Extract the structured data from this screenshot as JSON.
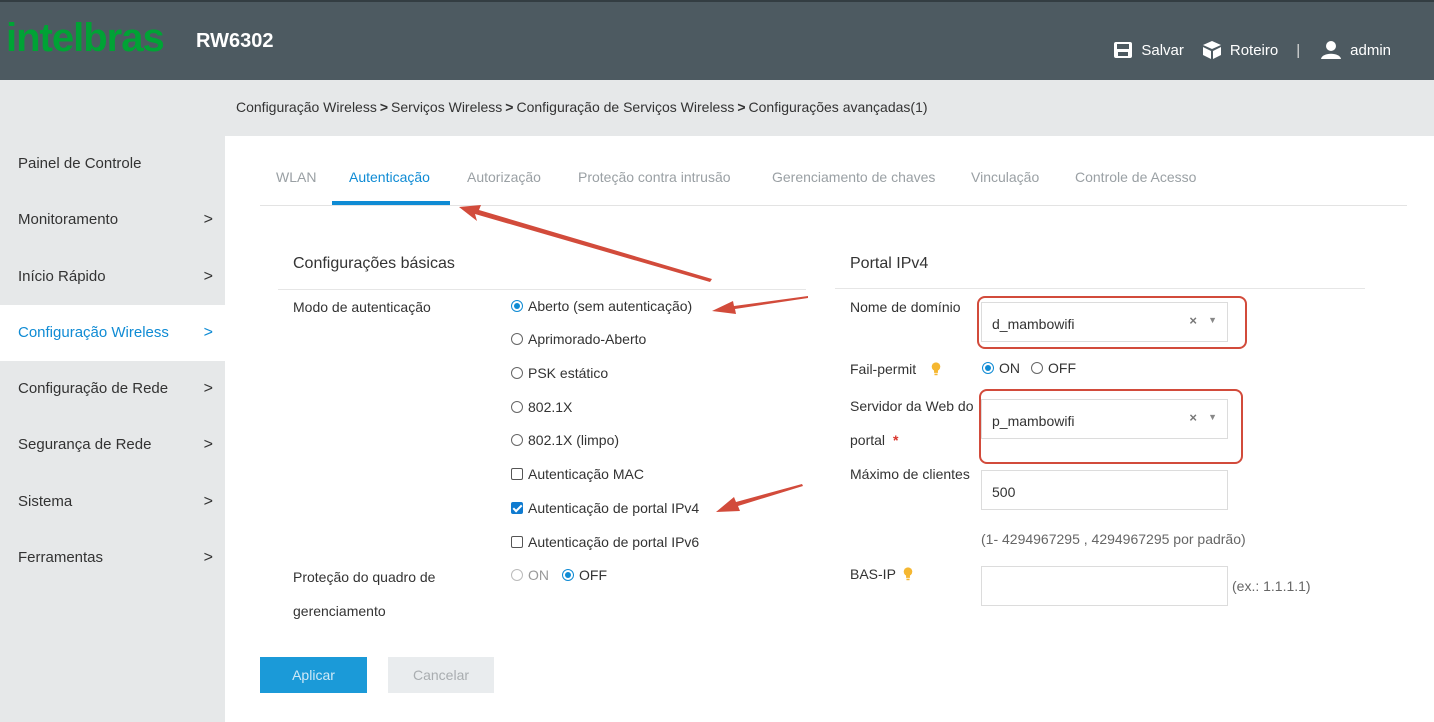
{
  "header": {
    "logo_text": "intelbras",
    "model": "RW6302",
    "save_label": "Salvar",
    "roadmap_label": "Roteiro",
    "separator": "|",
    "user_label": "admin",
    "brand_color": "#00a335",
    "bar_color": "#4d5a61"
  },
  "breadcrumb": {
    "items": [
      "Configuração Wireless",
      "Serviços Wireless",
      "Configuração de Serviços Wireless",
      "Configurações avançadas(1)"
    ],
    "separator": ">"
  },
  "sidebar": {
    "items": [
      {
        "label": "Painel de Controle",
        "has_arrow": false
      },
      {
        "label": "Monitoramento",
        "has_arrow": true
      },
      {
        "label": "Início Rápido",
        "has_arrow": true
      },
      {
        "label": "Configuração Wireless",
        "has_arrow": true,
        "active": true
      },
      {
        "label": "Configuração de Rede",
        "has_arrow": true
      },
      {
        "label": "Segurança de Rede",
        "has_arrow": true
      },
      {
        "label": "Sistema",
        "has_arrow": true
      },
      {
        "label": "Ferramentas",
        "has_arrow": true
      }
    ],
    "arrow": ">",
    "active_color": "#0f8bd4"
  },
  "tabs": {
    "items": [
      "WLAN",
      "Autenticação",
      "Autorização",
      "Proteção contra intrusão",
      "Gerenciamento de chaves",
      "Vinculação",
      "Controle de Acesso"
    ],
    "active": "Autenticação"
  },
  "basic": {
    "title": "Configurações básicas",
    "auth_mode_label": "Modo de autenticação",
    "auth_options": [
      "Aberto (sem autenticação)",
      "Aprimorado-Aberto",
      "PSK estático",
      "802.1X",
      "802.1X (limpo)"
    ],
    "auth_selected": "Aberto (sem autenticação)",
    "checkboxes": [
      {
        "label": "Autenticação MAC",
        "checked": false
      },
      {
        "label": "Autenticação de portal IPv4",
        "checked": true
      },
      {
        "label": "Autenticação de portal IPv6",
        "checked": false
      }
    ],
    "mgmt_frame_label_1": "Proteção do quadro de",
    "mgmt_frame_label_2": "gerenciamento",
    "mgmt_on": "ON",
    "mgmt_off": "OFF",
    "mgmt_selected": "OFF"
  },
  "portal": {
    "title": "Portal IPv4",
    "domain_label": "Nome de domínio",
    "domain_value": "d_mambowifi",
    "failpermit_label": "Fail-permit",
    "failpermit_on": "ON",
    "failpermit_off": "OFF",
    "failpermit_selected": "ON",
    "webserver_label_1": "Servidor da Web do",
    "webserver_label_2": "portal",
    "required_mark": "*",
    "webserver_value": "p_mambowifi",
    "max_clients_label": "Máximo de clientes",
    "max_clients_value": "500",
    "max_clients_hint": "(1- 4294967295 , 4294967295 por padrão)",
    "basip_label": "BAS-IP",
    "basip_value": "",
    "basip_hint": "(ex.: 1.1.1.1)",
    "clear_glyph": "×",
    "caret_glyph": "▼"
  },
  "actions": {
    "apply_label": "Aplicar",
    "cancel_label": "Cancelar"
  },
  "annotation_color": "#d24b3b",
  "accent_color": "#0f8bd4"
}
